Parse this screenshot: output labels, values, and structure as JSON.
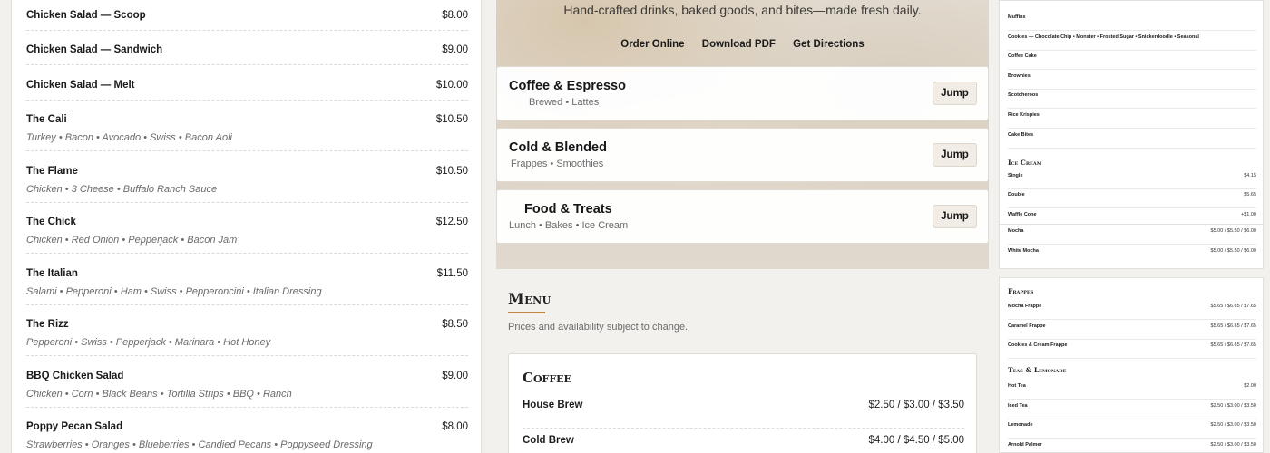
{
  "left_menu": [
    {
      "name": "Chicken Salad — Scoop",
      "price": "$8.00",
      "desc": ""
    },
    {
      "name": "Chicken Salad — Sandwich",
      "price": "$9.00",
      "desc": ""
    },
    {
      "name": "Chicken Salad — Melt",
      "price": "$10.00",
      "desc": ""
    },
    {
      "name": "The Cali",
      "price": "$10.50",
      "desc": "Turkey • Bacon • Avocado • Swiss • Bacon Aoli"
    },
    {
      "name": "The Flame",
      "price": "$10.50",
      "desc": "Chicken • 3 Cheese • Buffalo Ranch Sauce"
    },
    {
      "name": "The Chick",
      "price": "$12.50",
      "desc": "Chicken • Red Onion • Pepperjack • Bacon Jam"
    },
    {
      "name": "The Italian",
      "price": "$11.50",
      "desc": "Salami • Pepperoni • Ham • Swiss • Pepperoncini • Italian Dressing"
    },
    {
      "name": "The Rizz",
      "price": "$8.50",
      "desc": "Pepperoni • Swiss • Pepperjack • Marinara • Hot Honey"
    },
    {
      "name": "BBQ Chicken Salad",
      "price": "$9.00",
      "desc": "Chicken • Corn • Black Beans • Tortilla Strips • BBQ • Ranch"
    },
    {
      "name": "Poppy Pecan Salad",
      "price": "$8.00",
      "desc": "Strawberries • Oranges • Blueberries • Candied Pecans • Poppyseed Dressing"
    }
  ],
  "hero": {
    "tagline": "Hand-crafted drinks, baked goods, and bites—made fresh daily.",
    "links": [
      "Order Online",
      "Download PDF",
      "Get Directions"
    ]
  },
  "categories": [
    {
      "title": "Coffee & Espresso",
      "sub": "Brewed • Lattes",
      "jump": "Jump"
    },
    {
      "title": "Cold & Blended",
      "sub": "Frappes • Smoothies",
      "jump": "Jump"
    },
    {
      "title": "Food & Treats",
      "sub": "Lunch • Bakes • Ice Cream",
      "jump": "Jump"
    }
  ],
  "menu_section": {
    "heading": "Menu",
    "note": "Prices and availability subject to change."
  },
  "coffee": {
    "title": "Coffee",
    "items": [
      {
        "name": "House Brew",
        "price": "$2.50 / $3.00 / $3.50"
      },
      {
        "name": "Cold Brew",
        "price": "$4.00 / $4.50 / $5.00"
      }
    ]
  },
  "right_top": {
    "bakes": [
      {
        "name": "Muffins",
        "price": ""
      },
      {
        "name": "Cookies — Chocolate Chip • Monster • Frosted Sugar • Snickerdoodle • Seasonal",
        "price": ""
      },
      {
        "name": "Coffee Cake",
        "price": ""
      },
      {
        "name": "Brownies",
        "price": ""
      },
      {
        "name": "Scotcheroos",
        "price": ""
      },
      {
        "name": "Rice Krispies",
        "price": ""
      },
      {
        "name": "Cake Bites",
        "price": ""
      }
    ],
    "ice_cream_title": "Ice Cream",
    "ice_cream": [
      {
        "name": "Single",
        "price": "$4.15"
      },
      {
        "name": "Double",
        "price": "$5.65"
      },
      {
        "name": "Waffle Cone",
        "price": "+$1.00"
      }
    ]
  },
  "right_mid": [
    {
      "name": "Mocha",
      "price": "$5.00 / $5.50 / $6.00"
    },
    {
      "name": "White Mocha",
      "price": "$5.00 / $5.50 / $6.00"
    }
  ],
  "right_bottom": {
    "frappes_title": "Frappes",
    "frappes": [
      {
        "name": "Mocha Frappe",
        "price": "$5.65 / $6.65 / $7.65"
      },
      {
        "name": "Caramel Frappe",
        "price": "$5.65 / $6.65 / $7.65"
      },
      {
        "name": "Cookies & Cream Frappe",
        "price": "$5.65 / $6.65 / $7.65"
      }
    ],
    "teas_title": "Teas & Lemonade",
    "teas": [
      {
        "name": "Hot Tea",
        "price": "$2.00"
      },
      {
        "name": "Iced Tea",
        "price": "$2.50 / $3.00 / $3.50"
      },
      {
        "name": "Lemonade",
        "price": "$2.50 / $3.00 / $3.50"
      },
      {
        "name": "Arnold Palmer",
        "price": "$2.50 / $3.00 / $3.50"
      }
    ]
  }
}
